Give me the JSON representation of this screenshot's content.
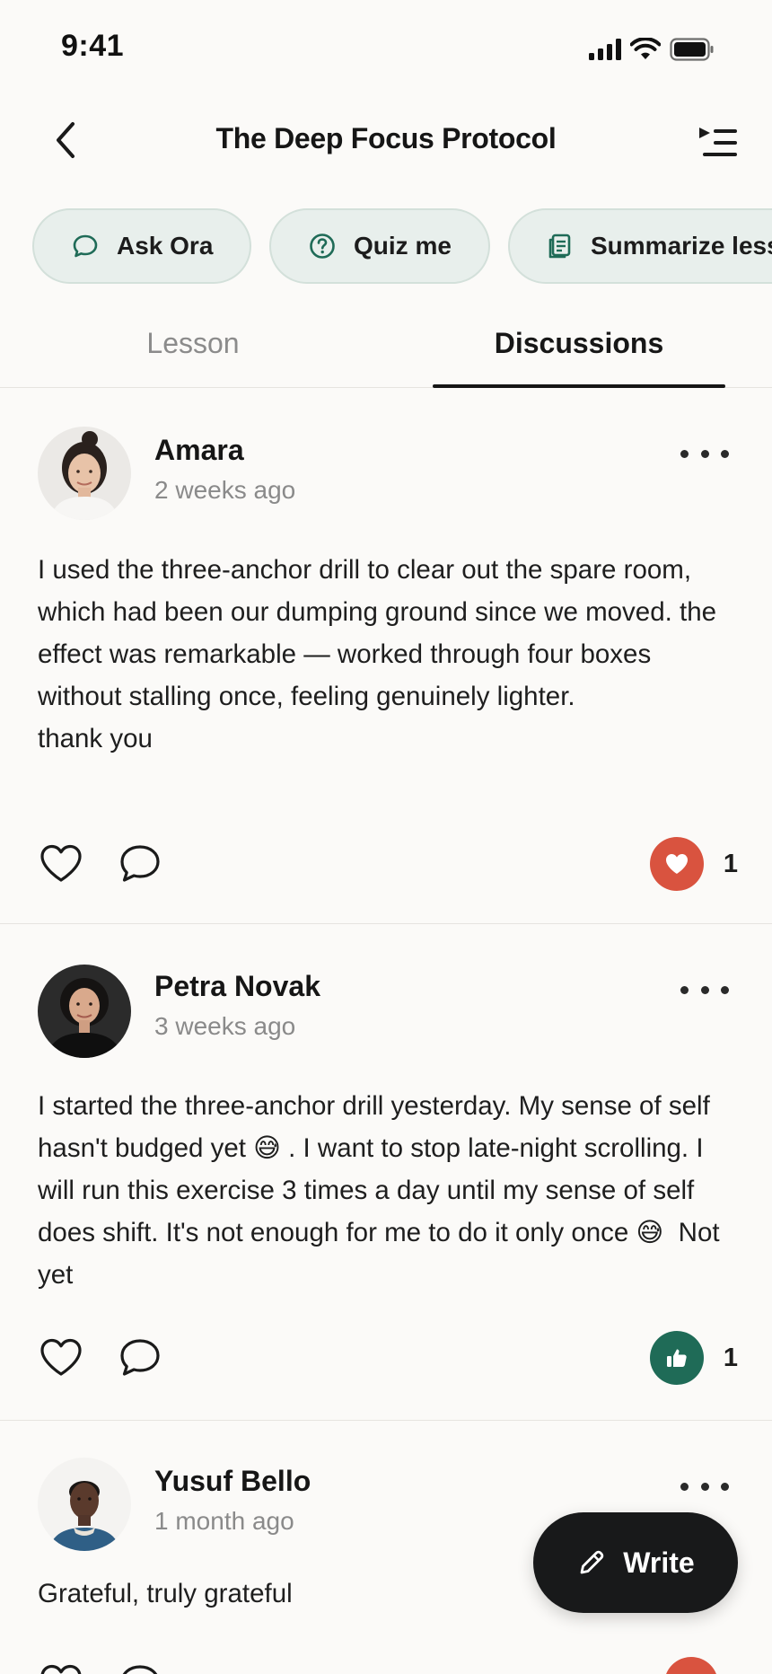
{
  "status_bar": {
    "time": "9:41"
  },
  "header": {
    "title": "The Deep Focus Protocol"
  },
  "chips": [
    {
      "label": "Ask Ora",
      "icon": "chat-bubble-icon"
    },
    {
      "label": "Quiz me",
      "icon": "question-circle-icon"
    },
    {
      "label": "Summarize lesson",
      "icon": "document-icon"
    }
  ],
  "tabs": {
    "lesson": "Lesson",
    "discussions": "Discussions",
    "active": "Discussions"
  },
  "posts": [
    {
      "author": "Amara",
      "time": "2 weeks ago",
      "body": "I used the three-anchor drill to clear out the spare room, which had been our dumping ground since we moved. the effect was remarkable — worked through four boxes without stalling once, feeling genuinely lighter.\nthank you",
      "reaction": {
        "type": "heart",
        "color": "#d9533f",
        "count": "1"
      }
    },
    {
      "author": "Petra Novak",
      "time": "3 weeks ago",
      "body": "I started the three-anchor drill yesterday. My sense of self hasn't budged yet 😅 . I want to stop late-night scrolling. I will run this exercise 3 times a day until my sense of self does shift. It's not enough for me to do it only once 😅  Not yet",
      "reaction": {
        "type": "thumbs-up",
        "color": "#1f6b57",
        "count": "1"
      }
    },
    {
      "author": "Yusuf Bello",
      "time": "1 month ago",
      "body": "Grateful, truly grateful",
      "reaction": {
        "type": "heart",
        "color": "#d9533f",
        "count": ""
      }
    }
  ],
  "fab": {
    "label": "Write"
  },
  "colors": {
    "accent_green": "#1f6b57",
    "heart_red": "#d9533f",
    "chip_bg": "#e8efec",
    "background": "#fbfaf8"
  }
}
